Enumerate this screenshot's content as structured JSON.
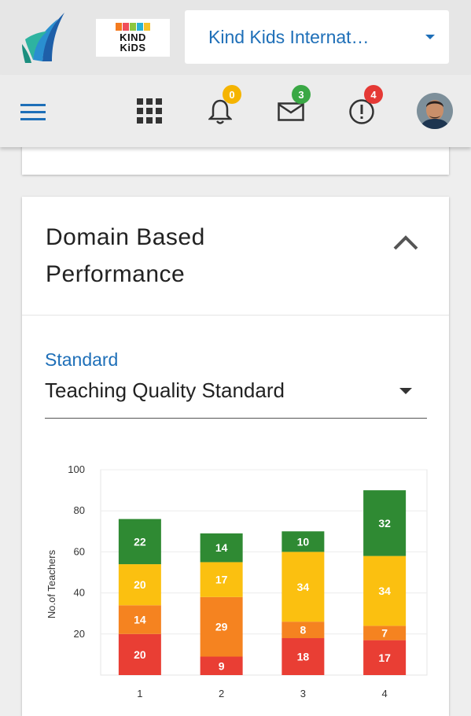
{
  "header": {
    "org_name": "Kind Kids Internat…",
    "kind_logo_text": [
      "KIND",
      "KiDS"
    ],
    "logo_colors": [
      "#f47b20",
      "#f04e5a",
      "#8dc63f",
      "#2bb2d3",
      "#f6c22a"
    ]
  },
  "toolbar": {
    "icons": [
      "menu-icon",
      "apps-grid-icon",
      "bell-icon",
      "mail-icon",
      "alert-icon"
    ],
    "notifications_count": "0",
    "messages_count": "3",
    "alerts_count": "4",
    "badge_colors": {
      "notifications": "#f5b400",
      "messages": "#3aa845",
      "alerts": "#e53935"
    }
  },
  "card": {
    "title_line1": "Domain Based",
    "title_line2": "Performance",
    "standard_label": "Standard",
    "standard_value": "Teaching Quality Standard"
  },
  "chart_data": {
    "type": "bar",
    "stacked": true,
    "categories": [
      "1",
      "2",
      "3",
      "4"
    ],
    "ylabel": "No.of Teachers",
    "ylim": [
      0,
      100
    ],
    "yticks": [
      "20",
      "40",
      "60",
      "80",
      "100"
    ],
    "series": [
      {
        "color": "#e93e34",
        "values": [
          20,
          9,
          18,
          17
        ]
      },
      {
        "color": "#f58320",
        "values": [
          14,
          29,
          8,
          7
        ]
      },
      {
        "color": "#fbc010",
        "values": [
          20,
          17,
          34,
          34
        ]
      },
      {
        "color": "#2f8a33",
        "values": [
          22,
          14,
          10,
          32
        ]
      }
    ]
  }
}
